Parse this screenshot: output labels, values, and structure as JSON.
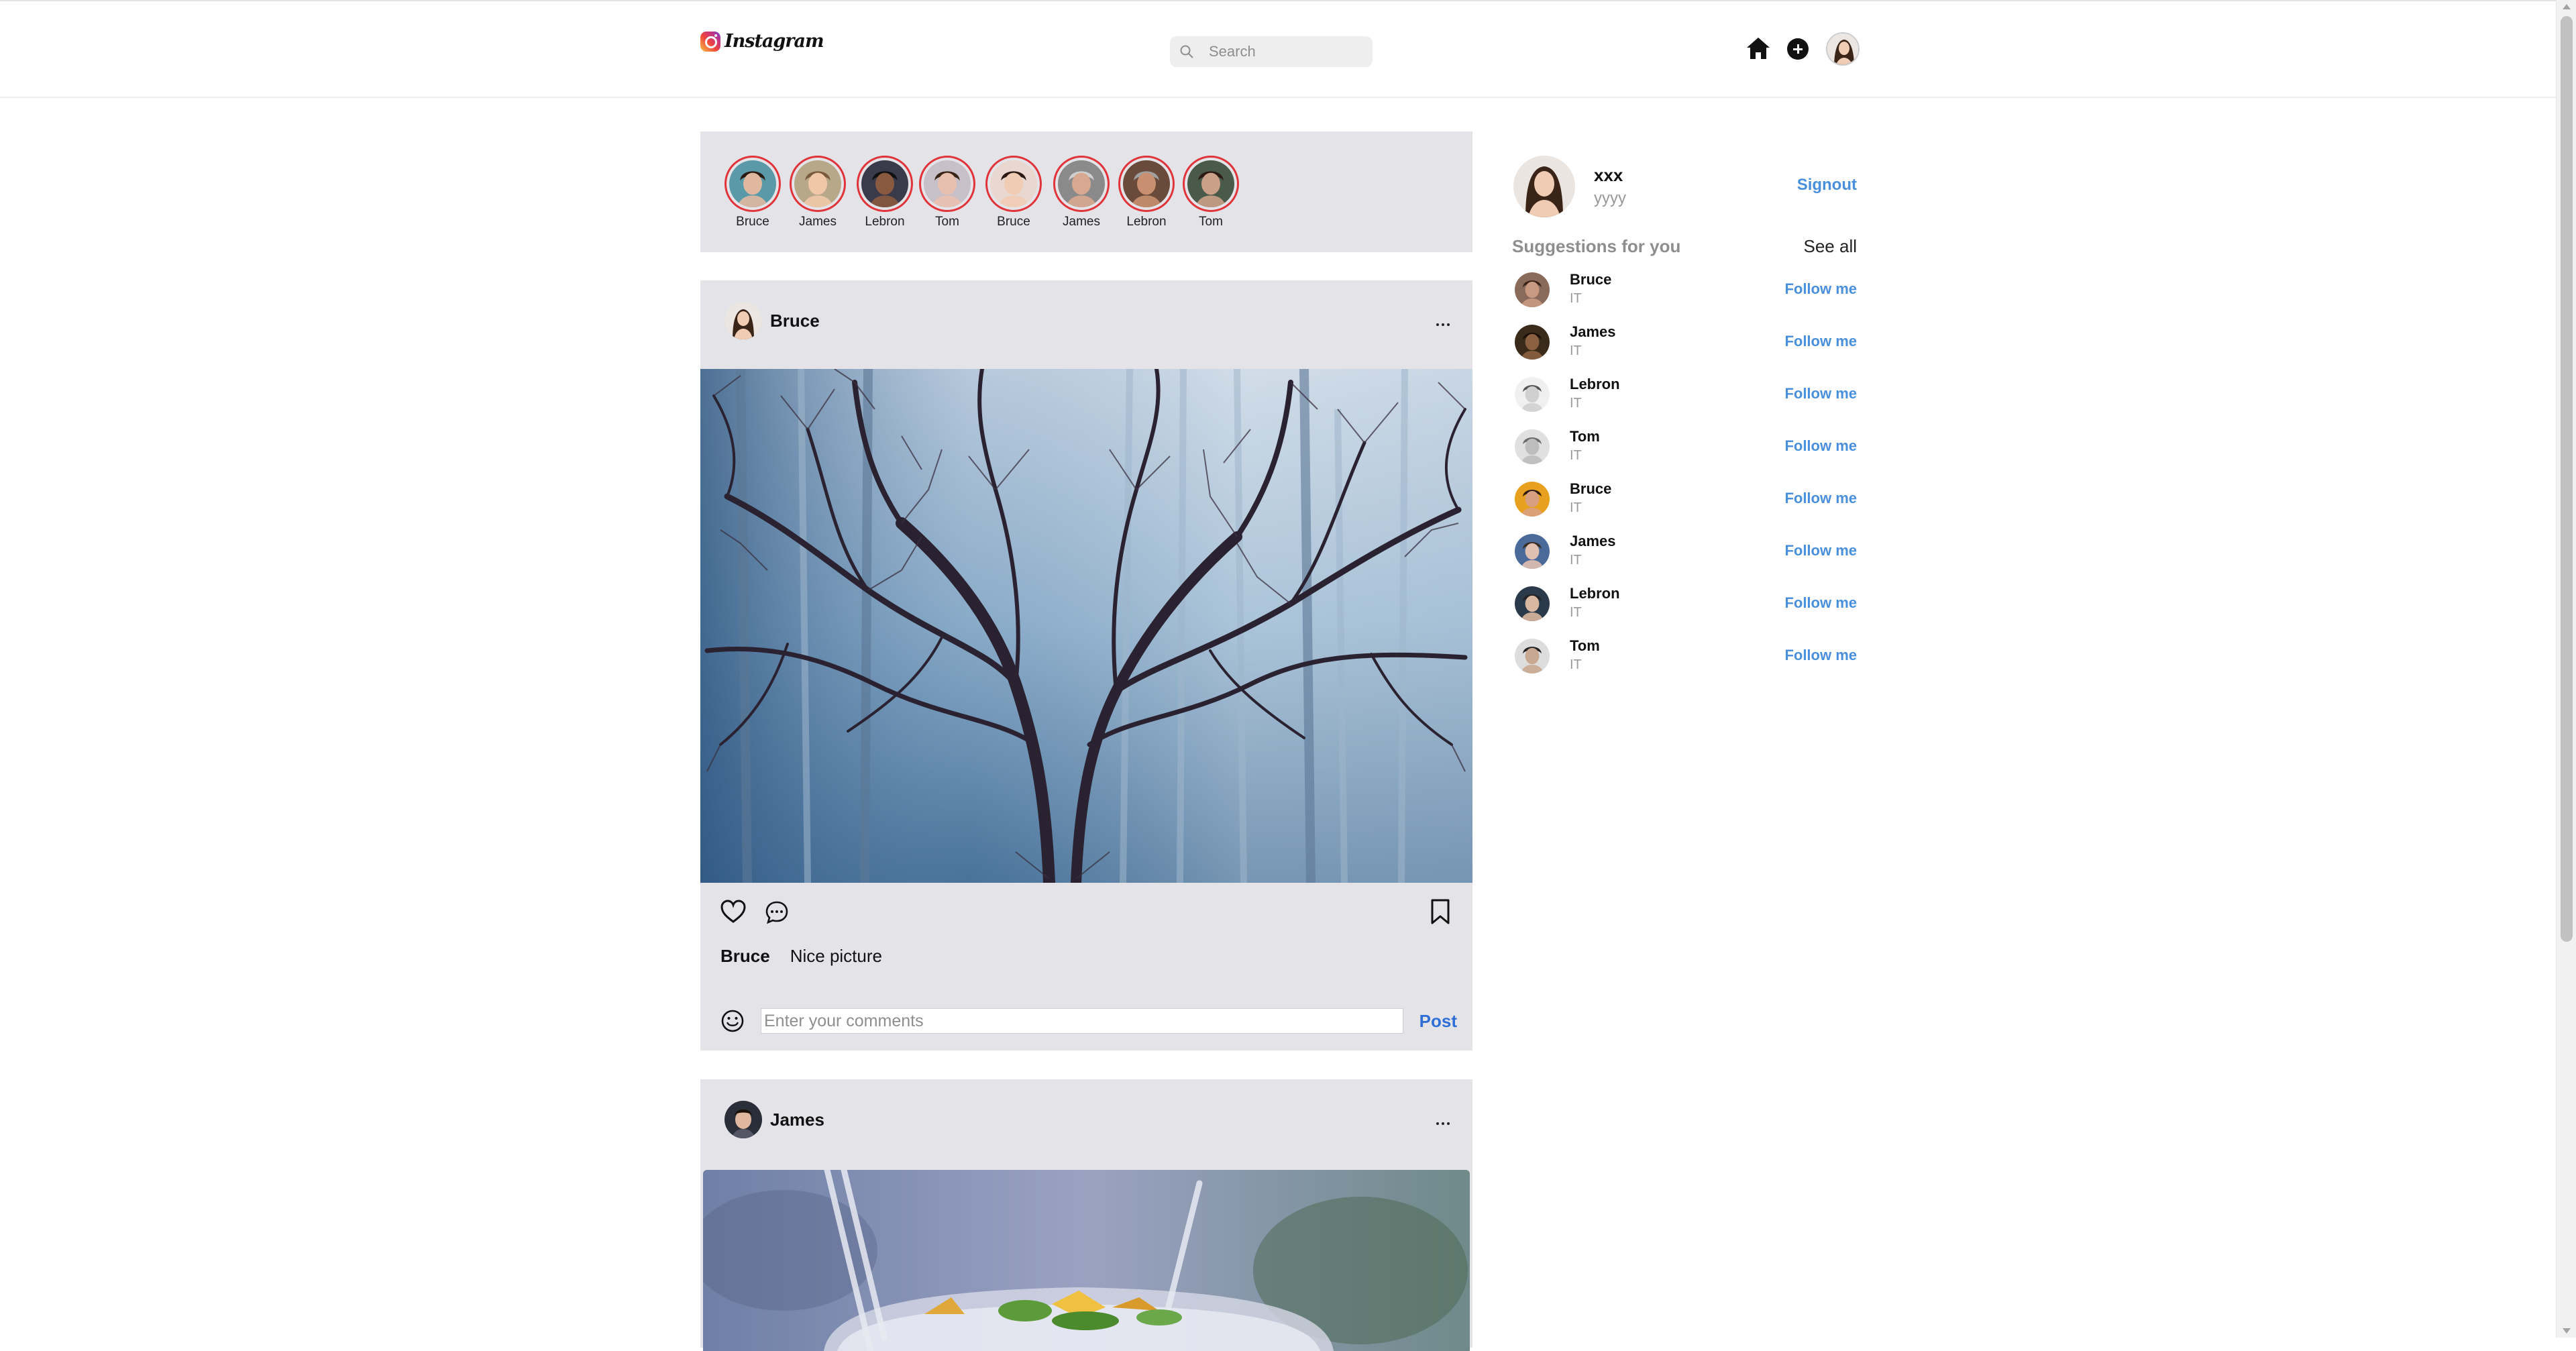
{
  "header": {
    "logo_text": "Instagram",
    "search_placeholder": "Search"
  },
  "stories": [
    {
      "name": "Bruce",
      "skin": "#e0b8a0",
      "hair": "#2a1a12",
      "bg": "#5a9aa8"
    },
    {
      "name": "James",
      "skin": "#f0c8a8",
      "hair": "#7a5a3a",
      "bg": "#b8a88a"
    },
    {
      "name": "Lebron",
      "skin": "#8a5a40",
      "hair": "#111",
      "bg": "#3a3a4a"
    },
    {
      "name": "Tom",
      "skin": "#e8c0b0",
      "hair": "#3a2418",
      "bg": "#c8c0c8"
    },
    {
      "name": "Bruce",
      "skin": "#f0ccb4",
      "hair": "#2a1a12",
      "bg": "#e8d8d0"
    },
    {
      "name": "James",
      "skin": "#d8a890",
      "hair": "#cfcfcf",
      "bg": "#8a8a8a"
    },
    {
      "name": "Lebron",
      "skin": "#c89070",
      "hair": "#a0a0a0",
      "bg": "#6a4a3a"
    },
    {
      "name": "Tom",
      "skin": "#caa088",
      "hair": "#2a1a12",
      "bg": "#4a5a4a"
    }
  ],
  "posts": [
    {
      "user": "Bruce",
      "caption_user": "Bruce",
      "caption_text": "Nice picture",
      "comment_placeholder": "Enter your comments",
      "post_label": "Post"
    },
    {
      "user": "James"
    }
  ],
  "profile": {
    "name": "xxx",
    "subtitle": "yyyy",
    "signout_label": "Signout"
  },
  "suggestions": {
    "title": "Suggestions for you",
    "see_all_label": "See all",
    "items": [
      {
        "name": "Bruce",
        "sub": "IT",
        "action": "Follow me",
        "skin": "#c89a82",
        "hair": "#3a2418",
        "bg": "#8a6a5a"
      },
      {
        "name": "James",
        "sub": "IT",
        "action": "Follow me",
        "skin": "#8a6040",
        "hair": "#1a1008",
        "bg": "#3a2a1a"
      },
      {
        "name": "Lebron",
        "sub": "IT",
        "action": "Follow me",
        "skin": "#d0d0d0",
        "hair": "#555",
        "bg": "#f0f0f0"
      },
      {
        "name": "Tom",
        "sub": "IT",
        "action": "Follow me",
        "skin": "#bdbdbd",
        "hair": "#6a6a6a",
        "bg": "#e0e0e0"
      },
      {
        "name": "Bruce",
        "sub": "IT",
        "action": "Follow me",
        "skin": "#d8a080",
        "hair": "#2a1a12",
        "bg": "#e8a020"
      },
      {
        "name": "James",
        "sub": "IT",
        "action": "Follow me",
        "skin": "#e0c0b0",
        "hair": "#3a2a22",
        "bg": "#4a6a9a"
      },
      {
        "name": "Lebron",
        "sub": "IT",
        "action": "Follow me",
        "skin": "#d8b8a0",
        "hair": "#222",
        "bg": "#2a3a4a"
      },
      {
        "name": "Tom",
        "sub": "IT",
        "action": "Follow me",
        "skin": "#c8a890",
        "hair": "#222",
        "bg": "#ddd"
      }
    ]
  },
  "colors": {
    "accent_blue": "#4a8fdc",
    "post_blue": "#2f6fd6",
    "story_ring": "#e0343a",
    "panel_bg": "#e4e4e8"
  }
}
